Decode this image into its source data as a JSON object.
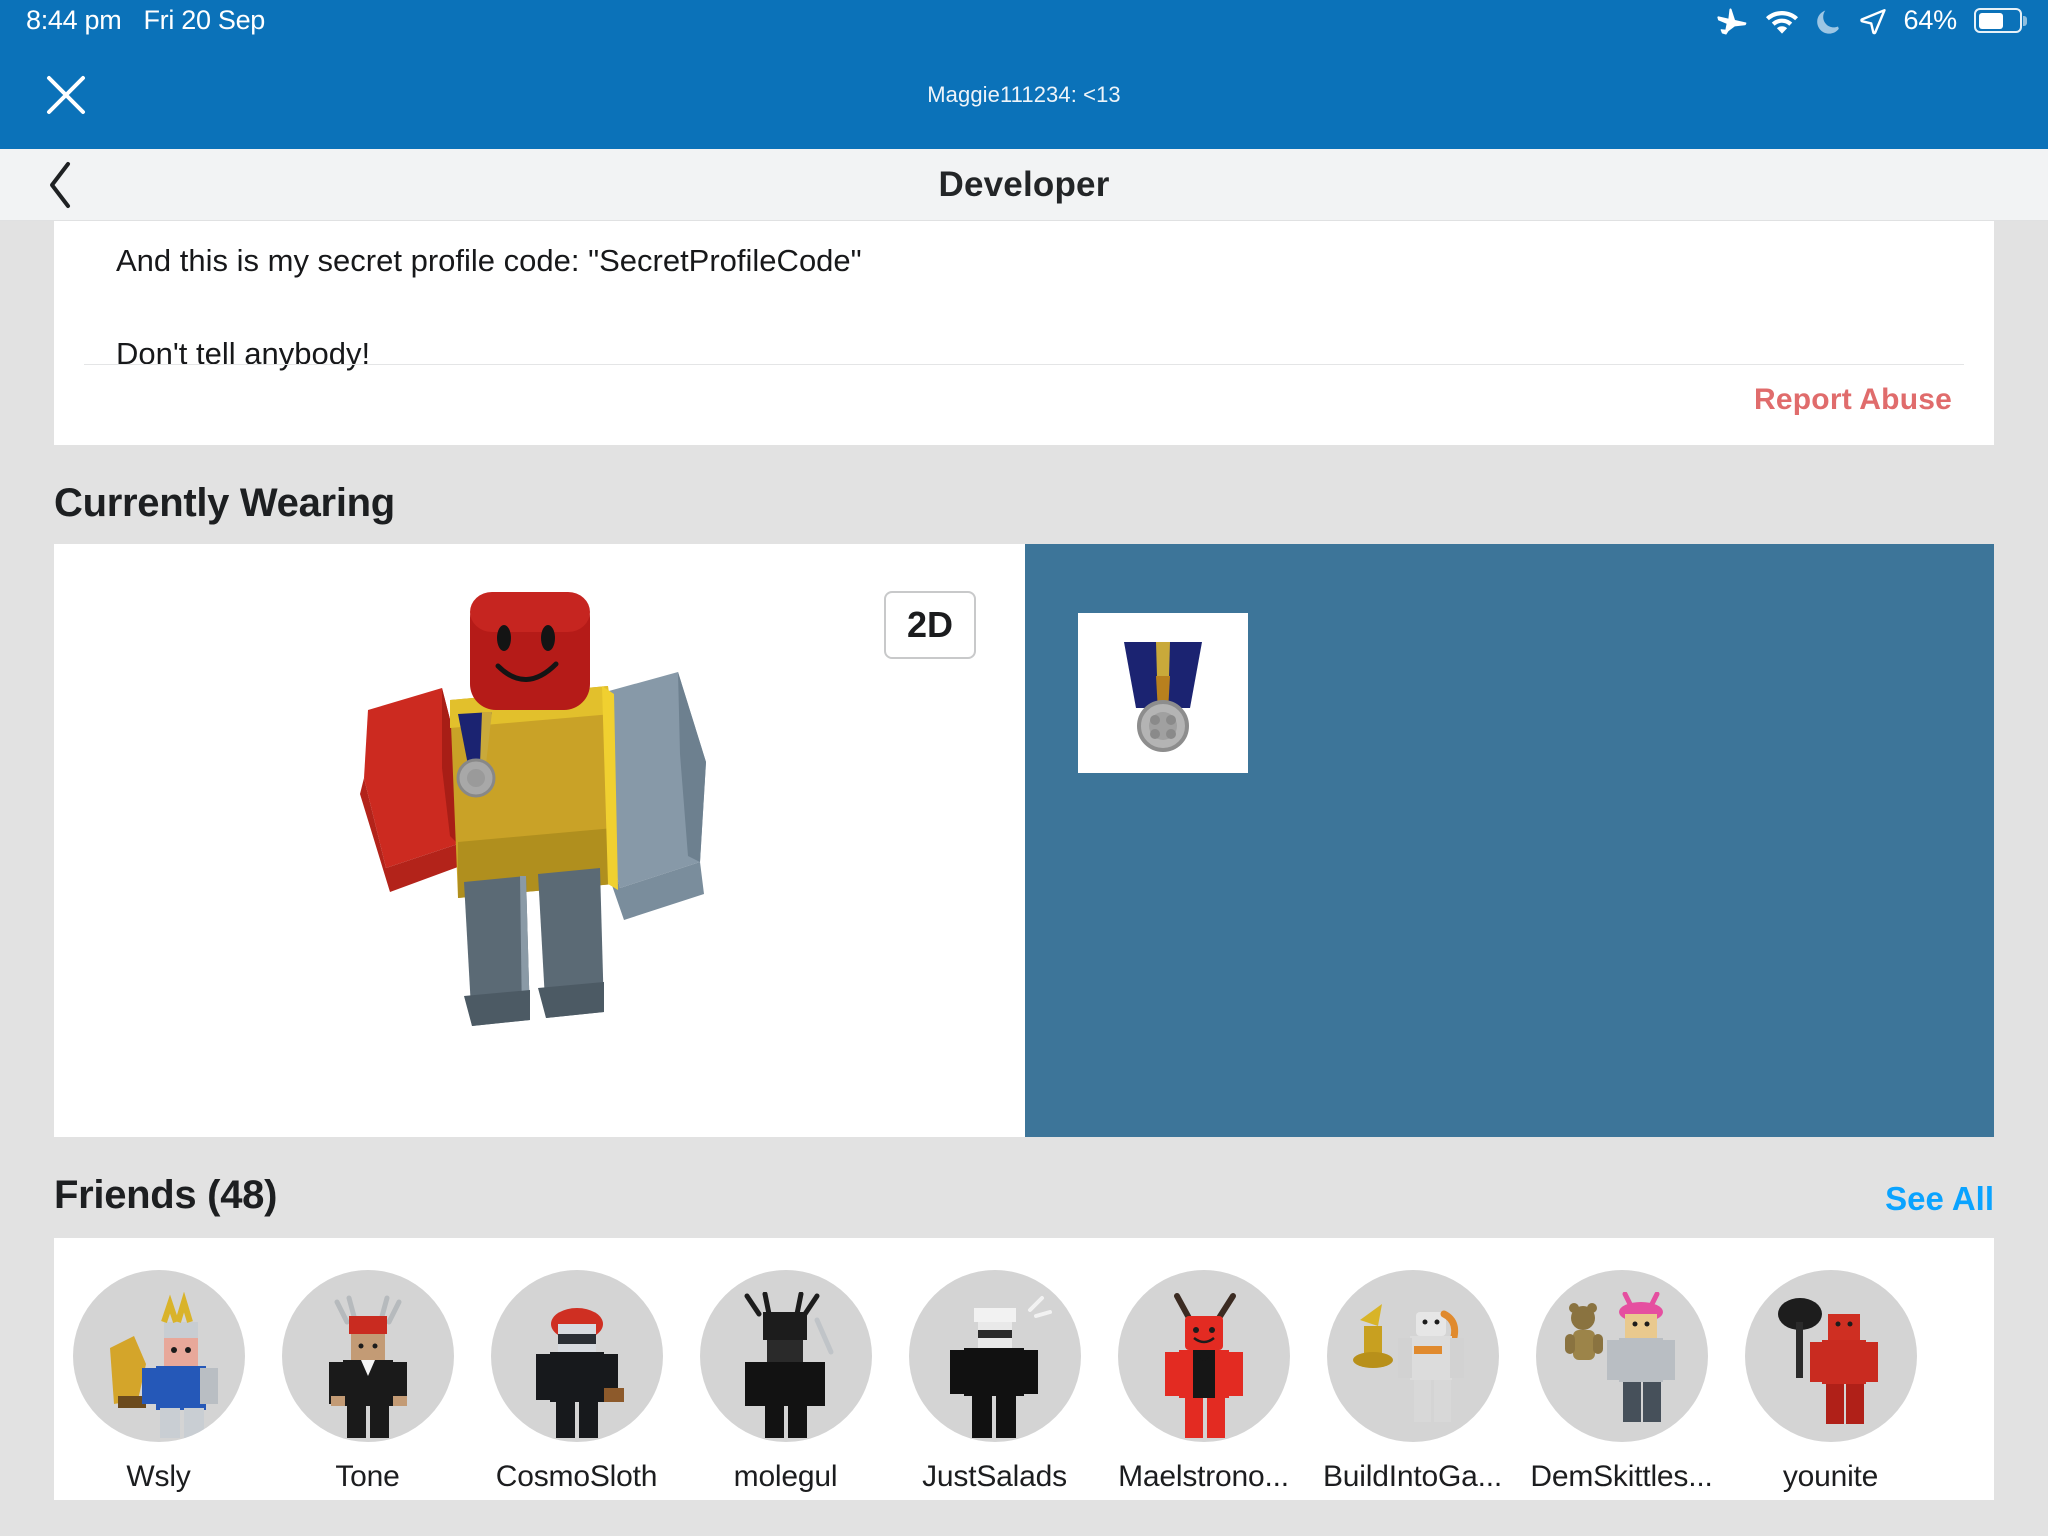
{
  "status_bar": {
    "time": "8:44 pm",
    "date": "Fri 20 Sep",
    "battery_percent": "64%",
    "battery_level": 64,
    "icons": [
      "airplane-mode-icon",
      "wifi-icon",
      "do-not-disturb-moon-icon",
      "location-arrow-icon",
      "battery-icon"
    ]
  },
  "chrome_bar": {
    "close_label": "close-icon",
    "title": "Maggie111234: <13",
    "background_color": "#0b72b9"
  },
  "nav_header": {
    "back_label": "back-chevron-icon",
    "title": "Developer"
  },
  "description": {
    "line1": "And this is my secret profile code: \"SecretProfileCode\"",
    "line2": "Don't tell anybody!",
    "report_abuse_label": "Report Abuse",
    "report_abuse_color": "#e06c6c"
  },
  "currently_wearing": {
    "title": "Currently Wearing",
    "toggle_label": "2D",
    "items_panel_color": "#3d7599",
    "avatar": {
      "name": "roblox-avatar-3d-render",
      "head_color": "#b51b18",
      "shirt_color": "#c9a227",
      "left_arm_color": "#cc2a20",
      "right_arm_color": "#8799a8",
      "pants_color": "#5b6a75"
    },
    "items": [
      {
        "name": "medal-ribbon-accessory",
        "ribbon_color": "#1b2371",
        "stripe_color": "#c9a93a",
        "medallion_color": "#a8a8a8"
      }
    ]
  },
  "friends": {
    "title": "Friends (48)",
    "count": 48,
    "see_all_label": "See All",
    "see_all_color": "#0aa3ff",
    "list": [
      {
        "name": "Wsly",
        "avatar": "avatar-trophy-crown-blue"
      },
      {
        "name": "Tone",
        "avatar": "avatar-antler-tuxedo"
      },
      {
        "name": "CosmoSloth",
        "avatar": "avatar-red-cap-black-suit"
      },
      {
        "name": "molegul",
        "avatar": "avatar-sword-black"
      },
      {
        "name": "JustSalads",
        "avatar": "avatar-white-helmet-black"
      },
      {
        "name": "Maelstrono...",
        "avatar": "avatar-red-antenna"
      },
      {
        "name": "BuildIntoGa...",
        "avatar": "avatar-gold-trophy-white"
      },
      {
        "name": "DemSkittles...",
        "avatar": "avatar-teddy-bear-pink"
      },
      {
        "name": "younite",
        "avatar": "avatar-black-hammer-red"
      }
    ]
  }
}
